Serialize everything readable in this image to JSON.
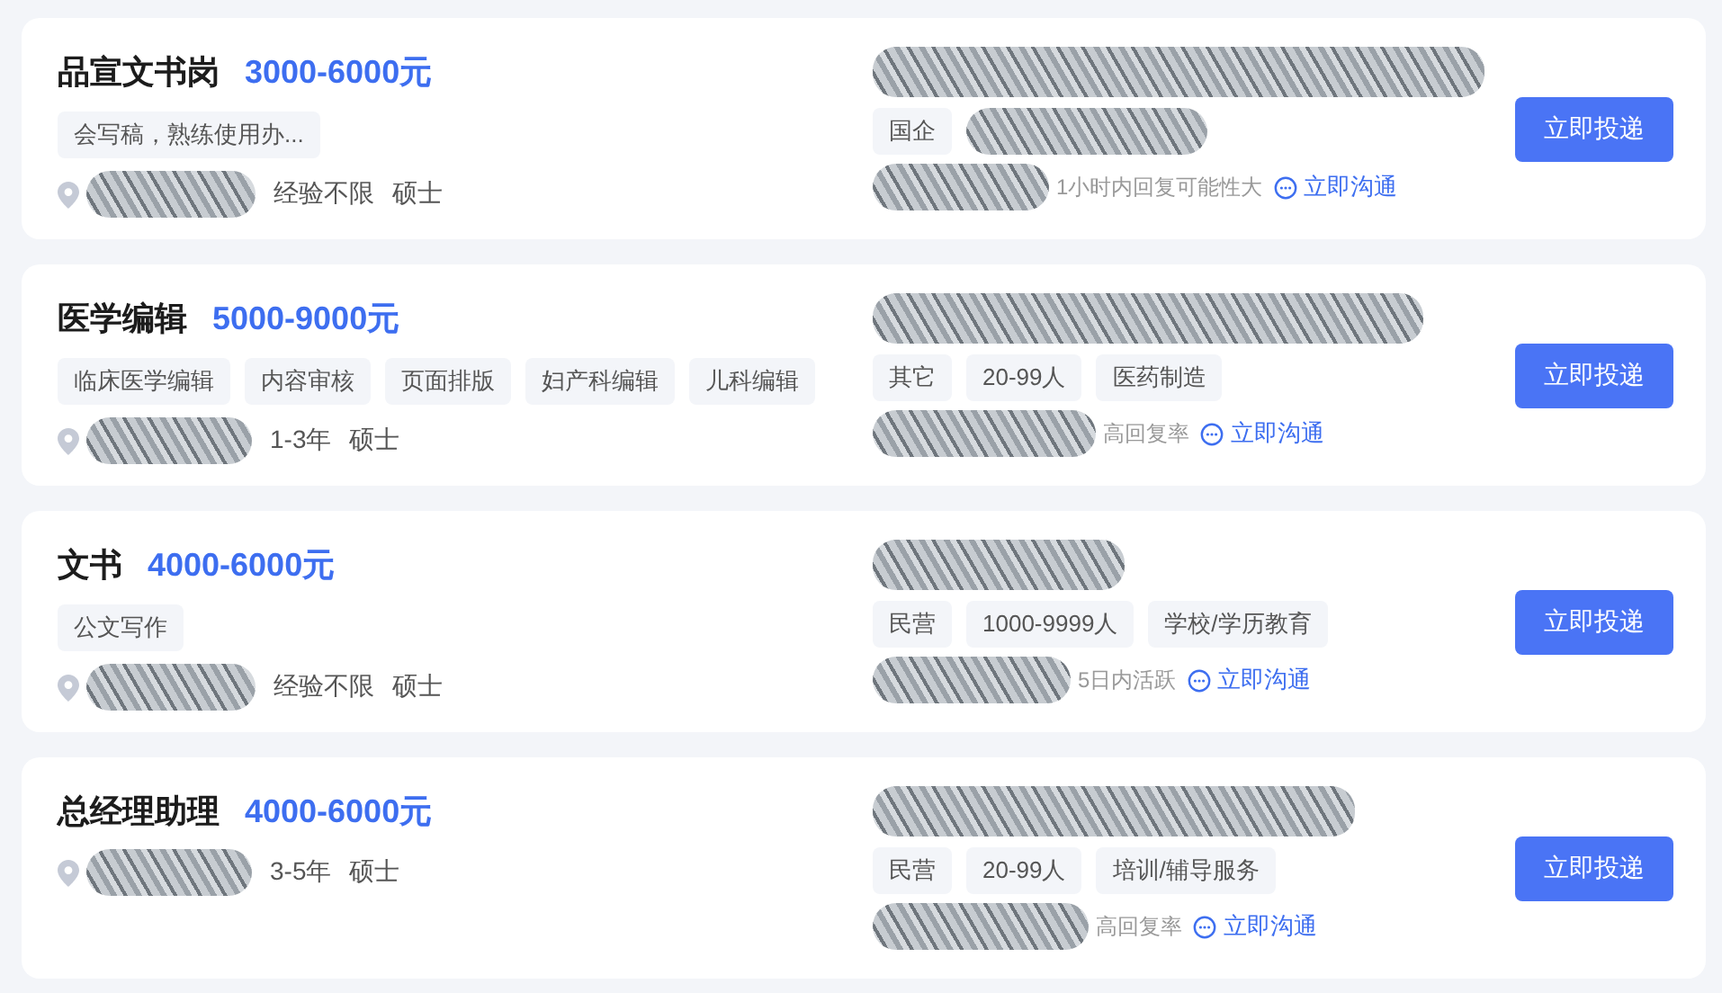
{
  "jobs": [
    {
      "title": "品宣文书岗",
      "salary": "3000-6000元",
      "skills": [
        "会写稿，熟练使用办..."
      ],
      "experience": "经验不限",
      "degree": "硕士",
      "company_tags": [
        {
          "kind": "text",
          "label": "国企"
        },
        {
          "kind": "redacted"
        }
      ],
      "activity": "1小时内回复可能性大",
      "chat_link": "立即沟通",
      "apply_button": "立即投递"
    },
    {
      "title": "医学编辑",
      "salary": "5000-9000元",
      "skills": [
        "临床医学编辑",
        "内容审核",
        "页面排版",
        "妇产科编辑",
        "儿科编辑"
      ],
      "experience": "1-3年",
      "degree": "硕士",
      "company_tags": [
        {
          "kind": "text",
          "label": "其它"
        },
        {
          "kind": "text",
          "label": "20-99人"
        },
        {
          "kind": "text",
          "label": "医药制造"
        }
      ],
      "activity": "高回复率",
      "chat_link": "立即沟通",
      "apply_button": "立即投递"
    },
    {
      "title": "文书",
      "salary": "4000-6000元",
      "skills": [
        "公文写作"
      ],
      "experience": "经验不限",
      "degree": "硕士",
      "company_tags": [
        {
          "kind": "text",
          "label": "民营"
        },
        {
          "kind": "text",
          "label": "1000-9999人"
        },
        {
          "kind": "text",
          "label": "学校/学历教育"
        }
      ],
      "activity": "5日内活跃",
      "chat_link": "立即沟通",
      "apply_button": "立即投递"
    },
    {
      "title": "总经理助理",
      "salary": "4000-6000元",
      "experience": "3-5年",
      "degree": "硕士",
      "company_tags": [
        {
          "kind": "text",
          "label": "民营"
        },
        {
          "kind": "text",
          "label": "20-99人"
        },
        {
          "kind": "text",
          "label": "培训/辅导服务"
        }
      ],
      "activity": "高回复率",
      "chat_link": "立即沟通",
      "apply_button": "立即投递"
    }
  ]
}
